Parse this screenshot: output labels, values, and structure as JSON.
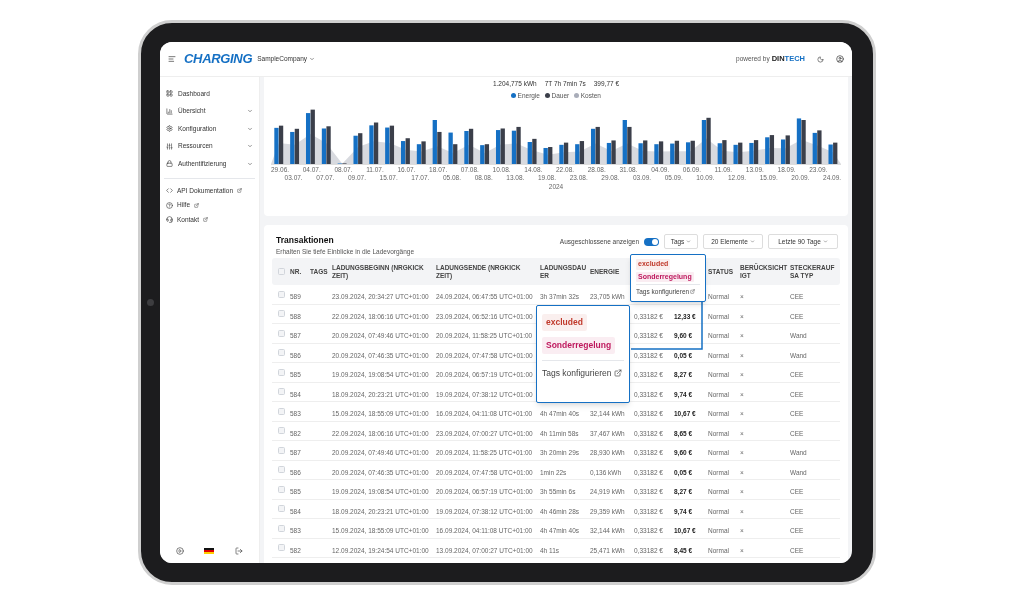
{
  "header": {
    "logo": "CHARGING",
    "company": "SampleCompany",
    "powered_by": "powered by",
    "brand_part_1": "DIN",
    "brand_part_2": "TECH"
  },
  "sidebar": {
    "nav_items": [
      {
        "label": "Dashboard",
        "has_submenu": false
      },
      {
        "label": "Übersicht",
        "has_submenu": true
      },
      {
        "label": "Konfiguration",
        "has_submenu": true
      },
      {
        "label": "Ressourcen",
        "has_submenu": true
      },
      {
        "label": "Authentifizierung",
        "has_submenu": true
      }
    ],
    "links": [
      {
        "label": "API Dokumentation",
        "external": true
      },
      {
        "label": "Hilfe",
        "external": true
      },
      {
        "label": "Kontakt",
        "external": true
      }
    ]
  },
  "chart": {
    "summary": [
      "1.204,775 kWh",
      "7T 7h 7min 7s",
      "399,77 €"
    ],
    "legend": [
      {
        "label": "Energie",
        "color": "#1570c4"
      },
      {
        "label": "Dauer",
        "color": "#3b3f4a"
      },
      {
        "label": "Kosten",
        "color": "#a9adb9"
      }
    ],
    "x_labels": [
      "29.06.",
      "03.07.",
      "04.07.",
      "07.07.",
      "08.07.",
      "09.07.",
      "11.07.",
      "15.07.",
      "16.07.",
      "17.07.",
      "18.07.",
      "05.08.",
      "07.08.",
      "08.08.",
      "10.08.",
      "13.08.",
      "14.08.",
      "19.08.",
      "22.08.",
      "23.08.",
      "28.08.",
      "29.08.",
      "31.08.",
      "03.09.",
      "04.09.",
      "05.09.",
      "06.09.",
      "10.09.",
      "11.09.",
      "12.09.",
      "13.09.",
      "15.09.",
      "18.09.",
      "20.09.",
      "23.09.",
      "24.09."
    ],
    "xlabel": "2024"
  },
  "transactions": {
    "title": "Transaktionen",
    "subtitle": "Erhalten Sie tiefe Einblicke in die Ladevorgänge",
    "toggle": {
      "label": "Ausgeschlossene anzeigen",
      "on": true
    },
    "buttons": [
      "Tags",
      "20 Elemente",
      "Letzte 90 Tage"
    ],
    "header_checkbox": {
      "checked": false
    },
    "columns": [
      "NR.",
      "TAGS",
      "LADUNGSBEGINN (NRGKICK ZEIT)",
      "LADUNGSENDE (NRGKICK ZEIT)",
      "LADUNGSDAUER",
      "ENERGIE",
      null,
      null,
      "STATUS",
      "BERÜCKSICHTIGT",
      "STECKERAUFSA TYP"
    ],
    "rows": [
      {
        "checked": false,
        "cells": [
          "589",
          null,
          "23.09.2024, 20:34:27 UTC+01:00",
          "24.09.2024, 06:47:55 UTC+01:00",
          "3h 37min 32s",
          "23,705 kWh",
          null,
          null,
          "Normal",
          "×",
          "CEE"
        ]
      },
      {
        "checked": false,
        "cells": [
          "588",
          null,
          "22.09.2024, 18:06:16 UTC+01:00",
          "23.09.2024, 06:52:16 UTC+01:00",
          null,
          null,
          "0,33182 €",
          "12,33 €",
          "Normal",
          "×",
          "CEE"
        ]
      },
      {
        "checked": false,
        "cells": [
          "587",
          null,
          "20.09.2024, 07:49:46 UTC+01:00",
          "20.09.2024, 11:58:25 UTC+01:00",
          null,
          null,
          "0,33182 €",
          "9,60 €",
          "Normal",
          "×",
          "Wand"
        ]
      },
      {
        "checked": false,
        "cells": [
          "586",
          null,
          "20.09.2024, 07:46:35 UTC+01:00",
          "20.09.2024, 07:47:58 UTC+01:00",
          null,
          null,
          "0,33182 €",
          "0,05 €",
          "Normal",
          "×",
          "Wand"
        ]
      },
      {
        "checked": false,
        "cells": [
          "585",
          null,
          "19.09.2024, 19:08:54 UTC+01:00",
          "20.09.2024, 06:57:19 UTC+01:00",
          null,
          null,
          "0,33182 €",
          "8,27 €",
          "Normal",
          "×",
          "CEE"
        ]
      },
      {
        "checked": false,
        "cells": [
          "584",
          null,
          "18.09.2024, 20:23:21 UTC+01:00",
          "19.09.2024, 07:38:12 UTC+01:00",
          null,
          null,
          "0,33182 €",
          "9,74 €",
          "Normal",
          "×",
          "CEE"
        ]
      },
      {
        "checked": false,
        "cells": [
          "583",
          null,
          "15.09.2024, 18:55:09 UTC+01:00",
          "16.09.2024, 04:11:08 UTC+01:00",
          "4h 47min 40s",
          "32,144 kWh",
          "0,33182 €",
          "10,67 €",
          "Normal",
          "×",
          "CEE"
        ]
      },
      {
        "checked": false,
        "cells": [
          "582",
          null,
          "22.09.2024, 18:06:16 UTC+01:00",
          "23.09.2024, 07:00:27 UTC+01:00",
          "4h 11min 58s",
          "37,467 kWh",
          "0,33182 €",
          "8,65 €",
          "Normal",
          "×",
          "CEE"
        ]
      },
      {
        "checked": false,
        "cells": [
          "587",
          null,
          "20.09.2024, 07:49:46 UTC+01:00",
          "20.09.2024, 11:58:25 UTC+01:00",
          "3h 20min 29s",
          "28,930 kWh",
          "0,33182 €",
          "9,60 €",
          "Normal",
          "×",
          "Wand"
        ]
      },
      {
        "checked": false,
        "cells": [
          "586",
          null,
          "20.09.2024, 07:46:35 UTC+01:00",
          "20.09.2024, 07:47:58 UTC+01:00",
          "1min 22s",
          "0,136 kWh",
          "0,33182 €",
          "0,05 €",
          "Normal",
          "×",
          "Wand"
        ]
      },
      {
        "checked": false,
        "cells": [
          "585",
          null,
          "19.09.2024, 19:08:54 UTC+01:00",
          "20.09.2024, 06:57:19 UTC+01:00",
          "3h 55min 6s",
          "24,919 kWh",
          "0,33182 €",
          "8,27 €",
          "Normal",
          "×",
          "CEE"
        ]
      },
      {
        "checked": false,
        "cells": [
          "584",
          null,
          "18.09.2024, 20:23:21 UTC+01:00",
          "19.09.2024, 07:38:12 UTC+01:00",
          "4h 46min 28s",
          "29,359 kWh",
          "0,33182 €",
          "9,74 €",
          "Normal",
          "×",
          "CEE"
        ]
      },
      {
        "checked": false,
        "cells": [
          "583",
          null,
          "15.09.2024, 18:55:09 UTC+01:00",
          "16.09.2024, 04:11:08 UTC+01:00",
          "4h 47min 40s",
          "32,144 kWh",
          "0,33182 €",
          "10,67 €",
          "Normal",
          "×",
          "CEE"
        ]
      },
      {
        "checked": false,
        "cells": [
          "582",
          null,
          "12.09.2024, 19:24:54 UTC+01:00",
          "13.09.2024, 07:00:27 UTC+01:00",
          "4h 11s",
          "25,471 kWh",
          "0,33182 €",
          "8,45 €",
          "Normal",
          "×",
          "CEE"
        ]
      }
    ],
    "tags_dropdown": {
      "tags": [
        {
          "label": "excluded",
          "color": "#c0392b"
        },
        {
          "label": "Sonderregelung",
          "color": "#be185d"
        }
      ],
      "configure": "Tags konfigurieren"
    },
    "magnified_dropdown": {
      "tags": [
        {
          "label": "excluded",
          "color": "#c0392b"
        },
        {
          "label": "Sonderregelung",
          "color": "#be185d"
        }
      ],
      "configure": "Tags konfigurieren"
    }
  }
}
